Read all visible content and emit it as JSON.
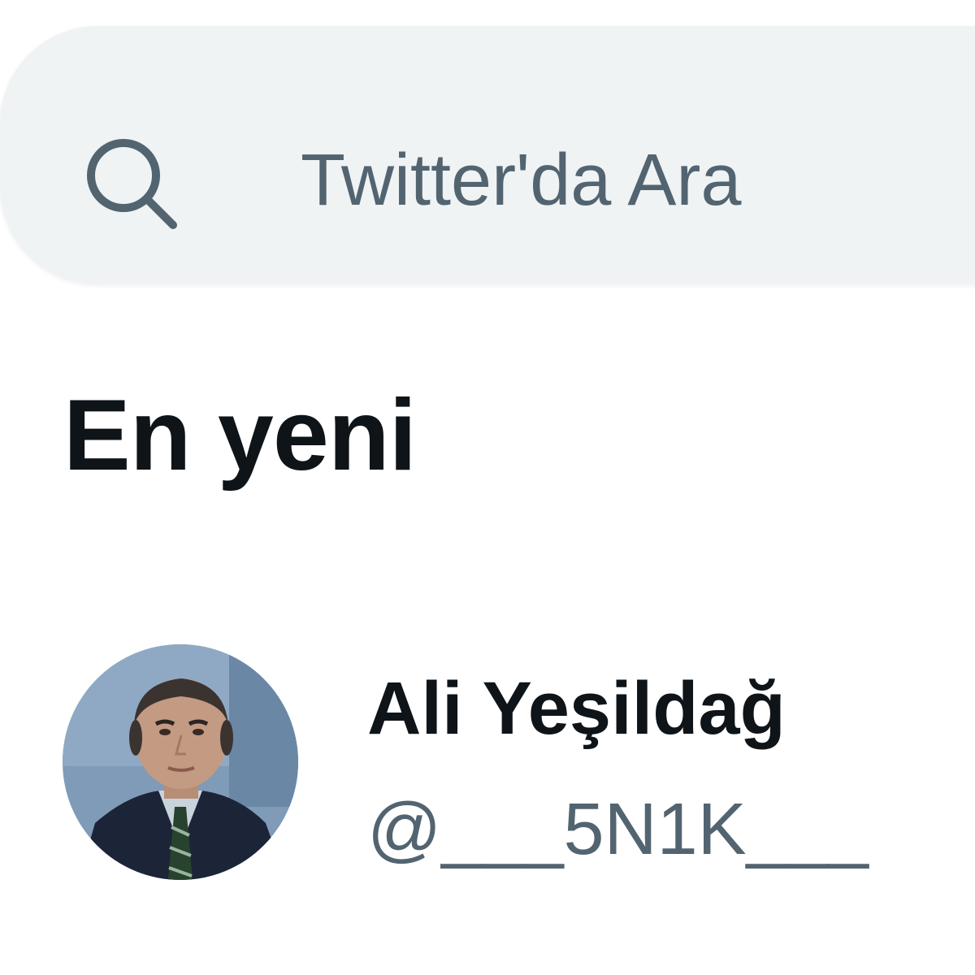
{
  "search": {
    "placeholder": "Twitter'da Ara",
    "icon": "search-icon"
  },
  "section": {
    "title": "En yeni"
  },
  "accounts": [
    {
      "name": "Ali Yeşildağ",
      "handle": "@___5N1K___",
      "avatar": "avatar-photo"
    }
  ],
  "colors": {
    "search_background": "#eff3f4",
    "primary_text": "#0f1419",
    "secondary_text": "#536471",
    "background": "#ffffff"
  }
}
